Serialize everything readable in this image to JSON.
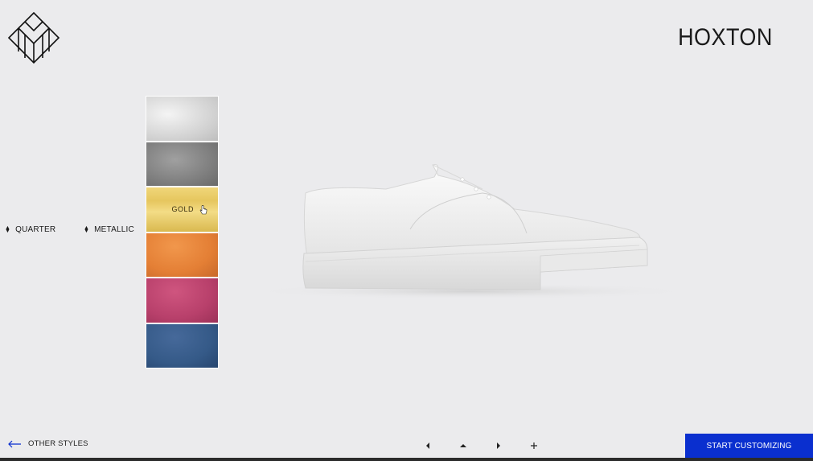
{
  "brand": {
    "logo_icon": "geometric-m-logo-icon"
  },
  "product": {
    "title": "HOXTON"
  },
  "selectors": {
    "part": {
      "label": "QUARTER",
      "icon": "updown-arrows-icon"
    },
    "material": {
      "label": "METALLIC",
      "icon": "updown-arrows-icon"
    }
  },
  "swatches": [
    {
      "name": "silver-light",
      "color": "#e2e2e2",
      "label": ""
    },
    {
      "name": "silver-dark",
      "color": "#8e8e8e",
      "label": ""
    },
    {
      "name": "gold",
      "color": "#e8cd6a",
      "label": "GOLD"
    },
    {
      "name": "orange",
      "color": "#e8853d",
      "label": ""
    },
    {
      "name": "pink",
      "color": "#c24773",
      "label": ""
    },
    {
      "name": "blue",
      "color": "#3a5f8e",
      "label": ""
    }
  ],
  "footer": {
    "other_styles": "OTHER STYLES",
    "cta": "START CUSTOMIZING",
    "nav": [
      "prev-icon",
      "up-icon",
      "next-icon",
      "plus-icon"
    ]
  },
  "colors": {
    "accent": "#0a2fcf",
    "background": "#ebebed"
  }
}
